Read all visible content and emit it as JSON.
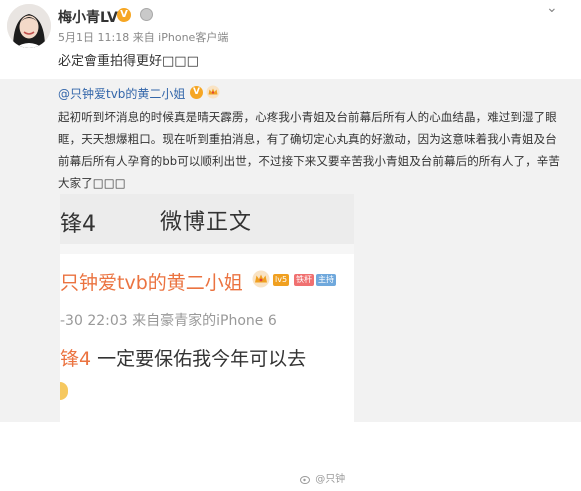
{
  "post": {
    "username": "梅小青LV",
    "meta": "5月1日 11:18 来自 iPhone客户端",
    "text": "必定會重拍得更好□□□"
  },
  "repost": {
    "author": "@只钟爱tvb的黄二小姐",
    "body": "起初听到坏消息的时候真是晴天霹雳，心疼我小青姐及台前幕后所有人的心血结晶，难过到湿了眼眶，天天想爆粗口。现在听到重拍消息，有了确切定心丸真的好激动，因为这意味着我小青姐及台前幕后所有人孕育的bb可以顺利出世，不过接下来又要辛苦我小青姐及台前幕后的所有人了，辛苦大家了□□□"
  },
  "embed": {
    "tab_fragment": "锋4",
    "title": "微博正文",
    "author": "只钟爱tvb的黄二小姐",
    "tags": [
      "lv5",
      "铁杆",
      "主持"
    ],
    "meta": "-30 22:03  来自豪青家的iPhone 6",
    "text_link": "锋4",
    "text_rest": " 一定要保佑我今年可以去",
    "watermark": "@只钟"
  },
  "colors": {
    "link": "#3366aa",
    "orange": "#eb7340",
    "vip": "#f6a623"
  }
}
